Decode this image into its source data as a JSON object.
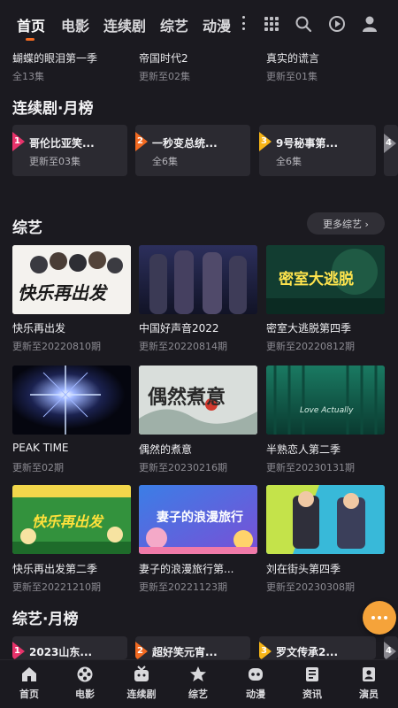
{
  "top_tabs": [
    "首页",
    "电影",
    "连续剧",
    "综艺",
    "动漫"
  ],
  "recent": [
    {
      "title": "蝴蝶的眼泪第一季",
      "sub": "全13集"
    },
    {
      "title": "帝国时代2",
      "sub": "更新至02集"
    },
    {
      "title": "真实的谎言",
      "sub": "更新至01集"
    }
  ],
  "series_rank": {
    "title": "连续剧·月榜",
    "items": [
      {
        "rank": "1",
        "name": "哥伦比亚笑...",
        "sub": "更新至03集",
        "color": "#e8336b"
      },
      {
        "rank": "2",
        "name": "一秒变总统...",
        "sub": "全6集",
        "color": "#f26a21"
      },
      {
        "rank": "3",
        "name": "9号秘事第...",
        "sub": "全6集",
        "color": "#f5b417"
      },
      {
        "rank": "4",
        "name": "",
        "sub": "",
        "color": "#8a8990"
      }
    ]
  },
  "variety": {
    "title": "综艺",
    "more_label": "更多综艺 ›",
    "tiles": [
      {
        "title": "快乐再出发",
        "sub": "更新至20220810期",
        "art": "快乐再出发"
      },
      {
        "title": "中国好声音2022",
        "sub": "更新至20220814期",
        "art": ""
      },
      {
        "title": "密室大逃脱第四季",
        "sub": "更新至20220812期",
        "art": "密室大逃脱"
      },
      {
        "title": "PEAK TIME",
        "sub": "更新至02期",
        "art": ""
      },
      {
        "title": "偶然的煮意",
        "sub": "更新至20230216期",
        "art": "偶然煮意"
      },
      {
        "title": "半熟恋人第二季",
        "sub": "更新至20230131期",
        "art": "Love Actually"
      },
      {
        "title": "快乐再出发第二季",
        "sub": "更新至20221210期",
        "art": "快乐再出发"
      },
      {
        "title": "妻子的浪漫旅行第...",
        "sub": "更新至20221123期",
        "art": "妻子的浪漫旅行"
      },
      {
        "title": "刘在街头第四季",
        "sub": "更新至20230308期",
        "art": ""
      }
    ]
  },
  "variety_rank": {
    "title": "综艺·月榜",
    "items": [
      {
        "rank": "1",
        "name": "2023山东...",
        "color": "#e8336b"
      },
      {
        "rank": "2",
        "name": "超好笑元宵...",
        "color": "#f26a21"
      },
      {
        "rank": "3",
        "name": "罗文传承2...",
        "color": "#f5b417"
      },
      {
        "rank": "4",
        "name": "",
        "color": "#8a8990"
      }
    ]
  },
  "bottom_nav": [
    "首页",
    "电影",
    "连续剧",
    "综艺",
    "动漫",
    "资讯",
    "演员"
  ],
  "accent_color": "#f26a21"
}
